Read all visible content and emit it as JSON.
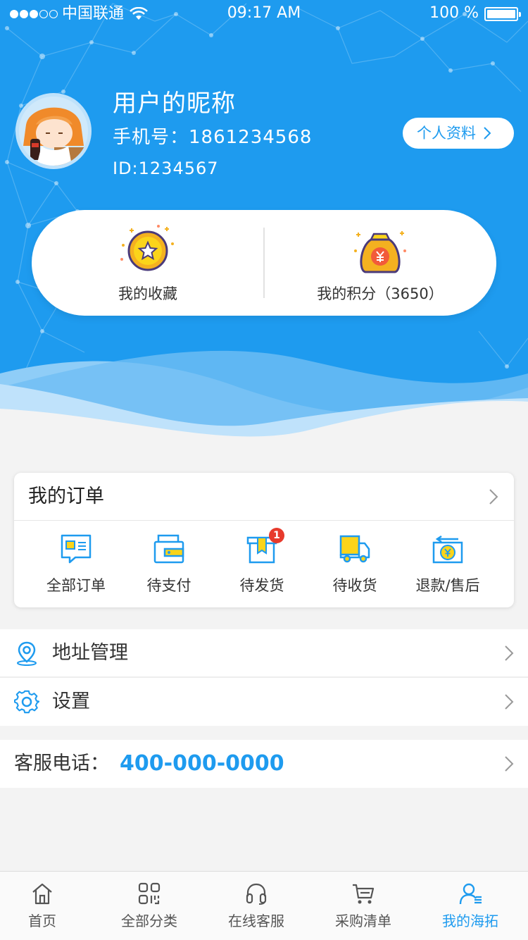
{
  "colors": {
    "primary": "#1e9bef",
    "badge": "#e73a2c",
    "icon_yellow": "#fbd41a",
    "background": "#f3f3f3"
  },
  "status_bar": {
    "carrier": "中国联通",
    "time": "09:17 AM",
    "battery": "100 %",
    "signal_filled": 3,
    "signal_total": 5,
    "battery_level": 1.0
  },
  "profile": {
    "nickname": "用户的昵称",
    "phone": "手机号：1861234568",
    "id": "ID:1234567",
    "edit_label": "个人资料",
    "avatar_icon": "user-avatar-image"
  },
  "quick": {
    "favorites": {
      "label": "我的收藏",
      "icon": "star-coin-icon"
    },
    "points": {
      "label": "我的积分（3650）",
      "icon": "money-bag-icon"
    }
  },
  "orders": {
    "title": "我的订单",
    "items": [
      {
        "label": "全部订单",
        "icon": "all-orders-icon"
      },
      {
        "label": "待支付",
        "icon": "wallet-icon"
      },
      {
        "label": "待发货",
        "icon": "package-icon",
        "badge": "1"
      },
      {
        "label": "待收货",
        "icon": "truck-icon"
      },
      {
        "label": "退款/售后",
        "icon": "refund-icon"
      }
    ]
  },
  "menu": {
    "address": {
      "label": "地址管理",
      "icon": "location-pin-icon"
    },
    "settings": {
      "label": "设置",
      "icon": "gear-icon"
    }
  },
  "service": {
    "label": "客服电话：",
    "number": "400-000-0000"
  },
  "tabs": [
    {
      "label": "首页",
      "icon": "home-icon"
    },
    {
      "label": "全部分类",
      "icon": "category-icon"
    },
    {
      "label": "在线客服",
      "icon": "headset-icon"
    },
    {
      "label": "采购清单",
      "icon": "cart-icon"
    },
    {
      "label": "我的海拓",
      "icon": "user-icon",
      "active": true
    }
  ]
}
